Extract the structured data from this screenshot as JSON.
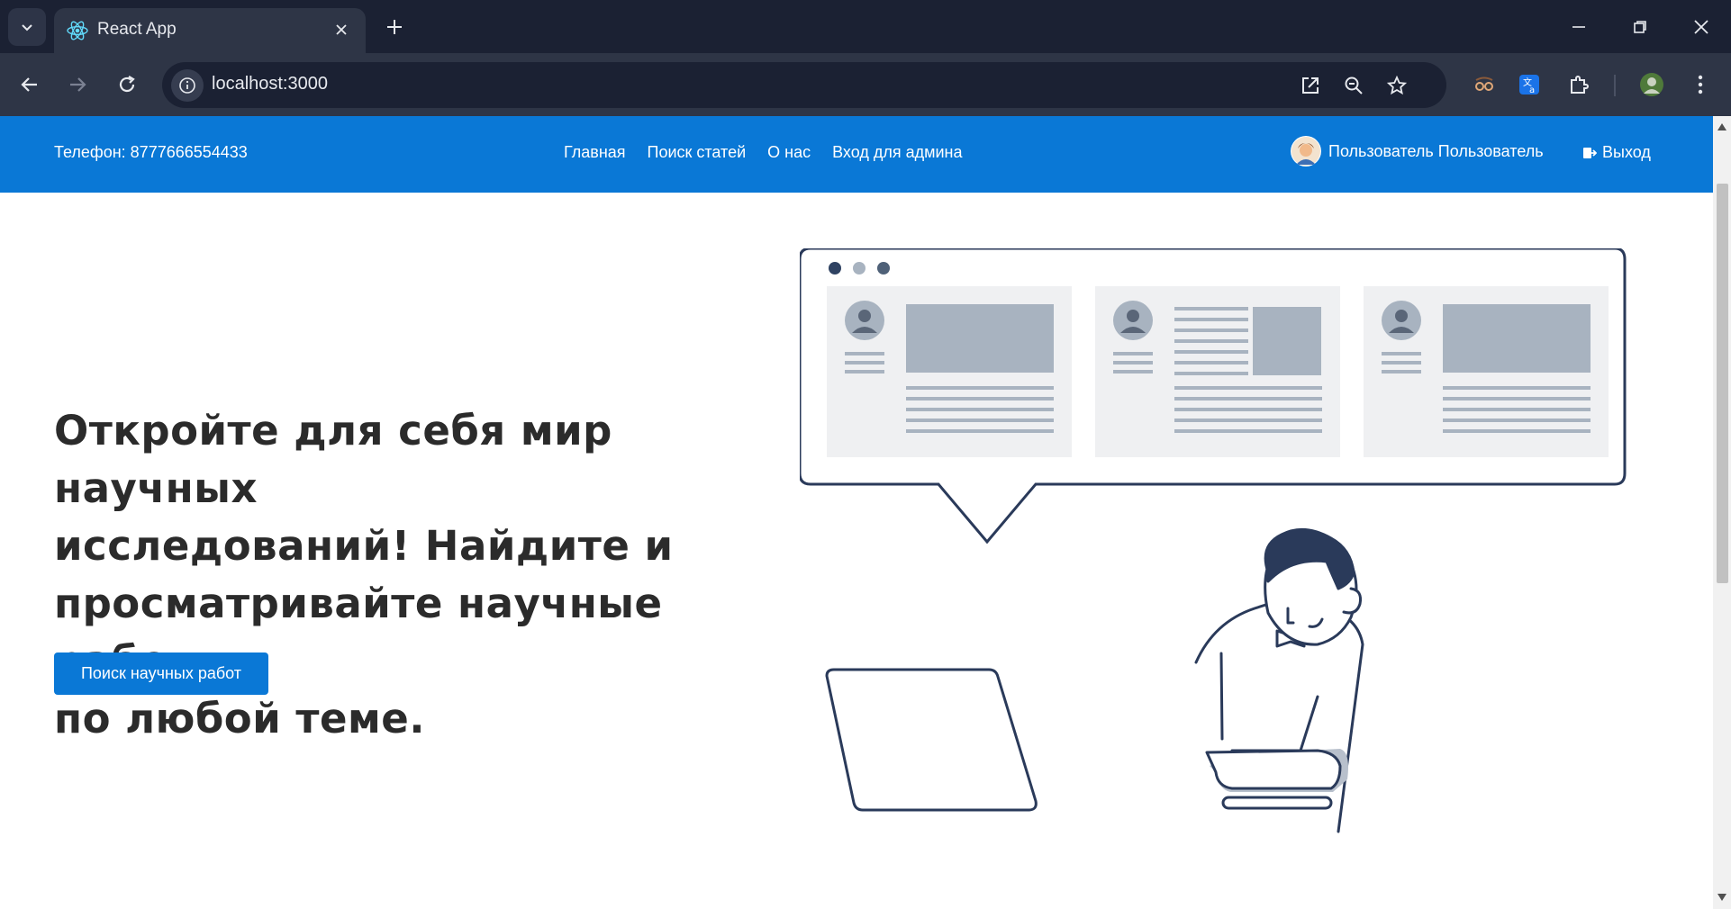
{
  "browser": {
    "tab_title": "React App",
    "url": "localhost:3000"
  },
  "header": {
    "phone": "Телефон: 8777666554433",
    "nav": [
      "Главная",
      "Поиск статей",
      "О нас",
      "Вход для админа"
    ],
    "user_name": "Пользователь Пользователь",
    "logout": "Выход",
    "accent_color": "#0a78d6"
  },
  "hero": {
    "title_lines": [
      "Откройте для себя мир научных",
      "исследований! Найдите и",
      "просматривайте научные работы",
      "по любой теме."
    ],
    "cta": "Поиск научных работ"
  }
}
